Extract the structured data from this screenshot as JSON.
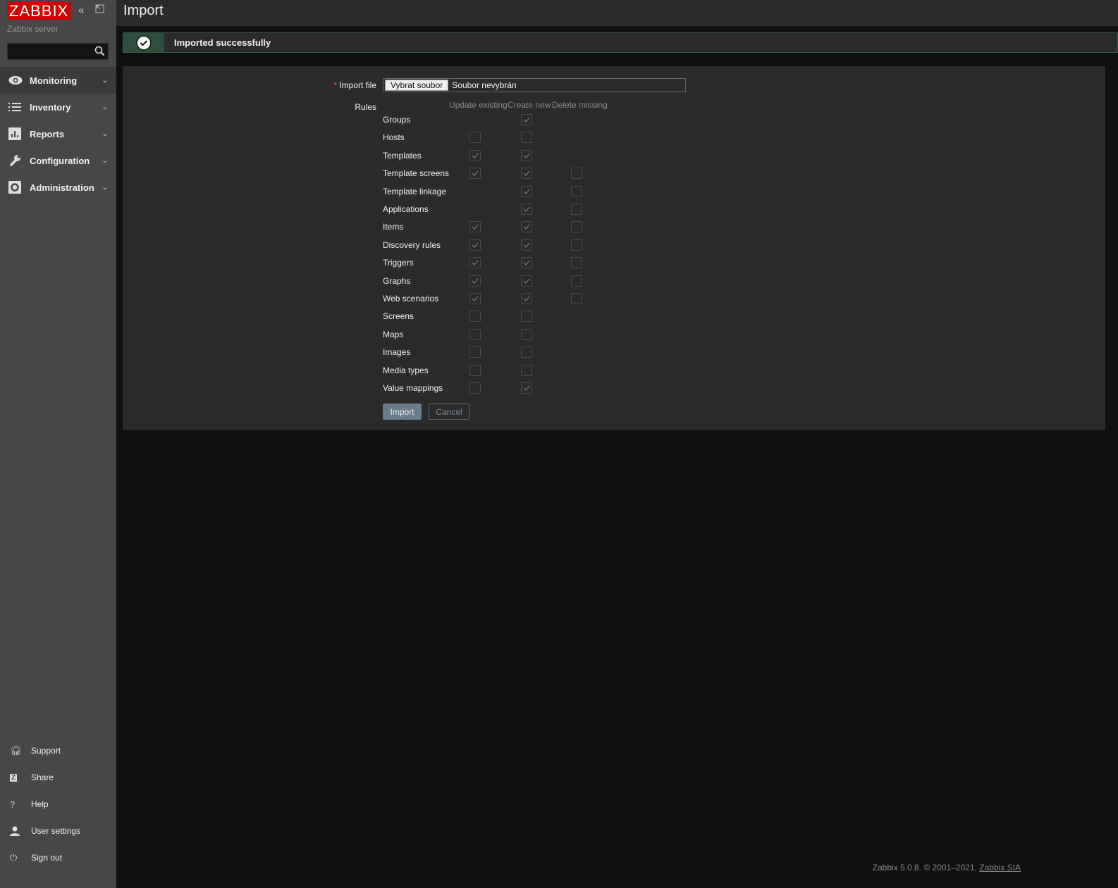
{
  "sidebar": {
    "logo": "ZABBIX",
    "server": "Zabbix server",
    "search_placeholder": "",
    "menu": [
      {
        "label": "Monitoring",
        "icon": "eye-icon"
      },
      {
        "label": "Inventory",
        "icon": "list-icon"
      },
      {
        "label": "Reports",
        "icon": "bar-chart-icon"
      },
      {
        "label": "Configuration",
        "icon": "wrench-icon"
      },
      {
        "label": "Administration",
        "icon": "gear-icon"
      }
    ],
    "bottom": [
      {
        "label": "Support",
        "icon": "headset-icon"
      },
      {
        "label": "Share",
        "icon": "share-icon"
      },
      {
        "label": "Help",
        "icon": "help-icon"
      },
      {
        "label": "User settings",
        "icon": "user-icon"
      },
      {
        "label": "Sign out",
        "icon": "power-icon"
      }
    ]
  },
  "header": {
    "title": "Import"
  },
  "message": {
    "text": "Imported successfully",
    "color": "#2f4f3e"
  },
  "form": {
    "import_file_label": "Import file",
    "required_mark": "*",
    "choose_button": "Vybrat soubor",
    "no_file": "Soubor nevybrán",
    "rules_label": "Rules",
    "columns": [
      "Update existing",
      "Create new",
      "Delete missing"
    ],
    "rules": [
      {
        "name": "Groups",
        "values": [
          null,
          true,
          null
        ]
      },
      {
        "name": "Hosts",
        "values": [
          false,
          false,
          null
        ]
      },
      {
        "name": "Templates",
        "values": [
          true,
          true,
          null
        ]
      },
      {
        "name": "Template screens",
        "values": [
          true,
          true,
          false
        ]
      },
      {
        "name": "Template linkage",
        "values": [
          null,
          true,
          false
        ]
      },
      {
        "name": "Applications",
        "values": [
          null,
          true,
          false
        ]
      },
      {
        "name": "Items",
        "values": [
          true,
          true,
          false
        ]
      },
      {
        "name": "Discovery rules",
        "values": [
          true,
          true,
          false
        ]
      },
      {
        "name": "Triggers",
        "values": [
          true,
          true,
          false
        ]
      },
      {
        "name": "Graphs",
        "values": [
          true,
          true,
          false
        ]
      },
      {
        "name": "Web scenarios",
        "values": [
          true,
          true,
          false
        ]
      },
      {
        "name": "Screens",
        "values": [
          false,
          false,
          null
        ]
      },
      {
        "name": "Maps",
        "values": [
          false,
          false,
          null
        ]
      },
      {
        "name": "Images",
        "values": [
          false,
          false,
          null
        ]
      },
      {
        "name": "Media types",
        "values": [
          false,
          false,
          null
        ]
      },
      {
        "name": "Value mappings",
        "values": [
          false,
          true,
          null
        ]
      }
    ],
    "import_button": "Import",
    "cancel_button": "Cancel"
  },
  "footer": {
    "text": "Zabbix 5.0.8. © 2001–2021, ",
    "link": "Zabbix SIA"
  }
}
